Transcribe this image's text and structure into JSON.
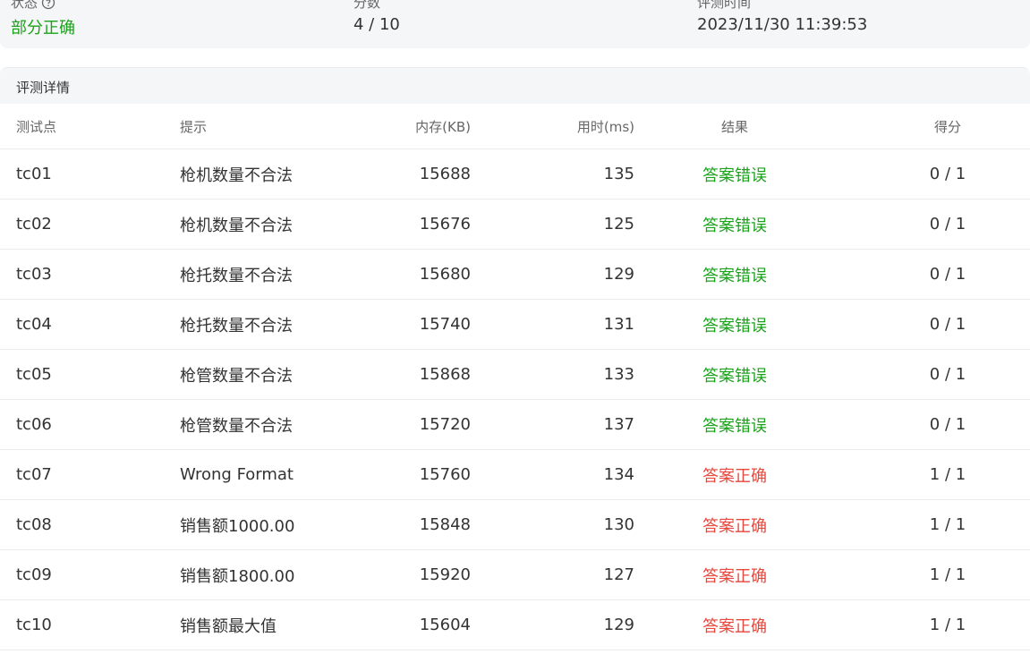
{
  "summary": {
    "status_label": "状态",
    "status_value": "部分正确",
    "score_label": "分数",
    "score_value": "4 / 10",
    "time_label": "评测时间",
    "time_value": "2023/11/30 11:39:53"
  },
  "details": {
    "title": "评测详情",
    "columns": [
      "测试点",
      "提示",
      "内存(KB)",
      "用时(ms)",
      "结果",
      "得分"
    ],
    "rows": [
      {
        "tc": "tc01",
        "hint": "枪机数量不合法",
        "memory": "15688",
        "time": "135",
        "result": "答案错误",
        "score": "0 / 1"
      },
      {
        "tc": "tc02",
        "hint": "枪机数量不合法",
        "memory": "15676",
        "time": "125",
        "result": "答案错误",
        "score": "0 / 1"
      },
      {
        "tc": "tc03",
        "hint": "枪托数量不合法",
        "memory": "15680",
        "time": "129",
        "result": "答案错误",
        "score": "0 / 1"
      },
      {
        "tc": "tc04",
        "hint": "枪托数量不合法",
        "memory": "15740",
        "time": "131",
        "result": "答案错误",
        "score": "0 / 1"
      },
      {
        "tc": "tc05",
        "hint": "枪管数量不合法",
        "memory": "15868",
        "time": "133",
        "result": "答案错误",
        "score": "0 / 1"
      },
      {
        "tc": "tc06",
        "hint": "枪管数量不合法",
        "memory": "15720",
        "time": "137",
        "result": "答案错误",
        "score": "0 / 1"
      },
      {
        "tc": "tc07",
        "hint": "Wrong Format",
        "memory": "15760",
        "time": "134",
        "result": "答案正确",
        "score": "1 / 1"
      },
      {
        "tc": "tc08",
        "hint": "销售额1000.00",
        "memory": "15848",
        "time": "130",
        "result": "答案正确",
        "score": "1 / 1"
      },
      {
        "tc": "tc09",
        "hint": "销售额1800.00",
        "memory": "15920",
        "time": "127",
        "result": "答案正确",
        "score": "1 / 1"
      },
      {
        "tc": "tc10",
        "hint": "销售额最大值",
        "memory": "15604",
        "time": "129",
        "result": "答案正确",
        "score": "1 / 1"
      }
    ]
  },
  "colors": {
    "status_partial": "#1aa31a",
    "result_wrong": "#1aa31a",
    "result_correct": "#e8473b"
  },
  "icons": {
    "status_help": "question-circle-icon"
  }
}
